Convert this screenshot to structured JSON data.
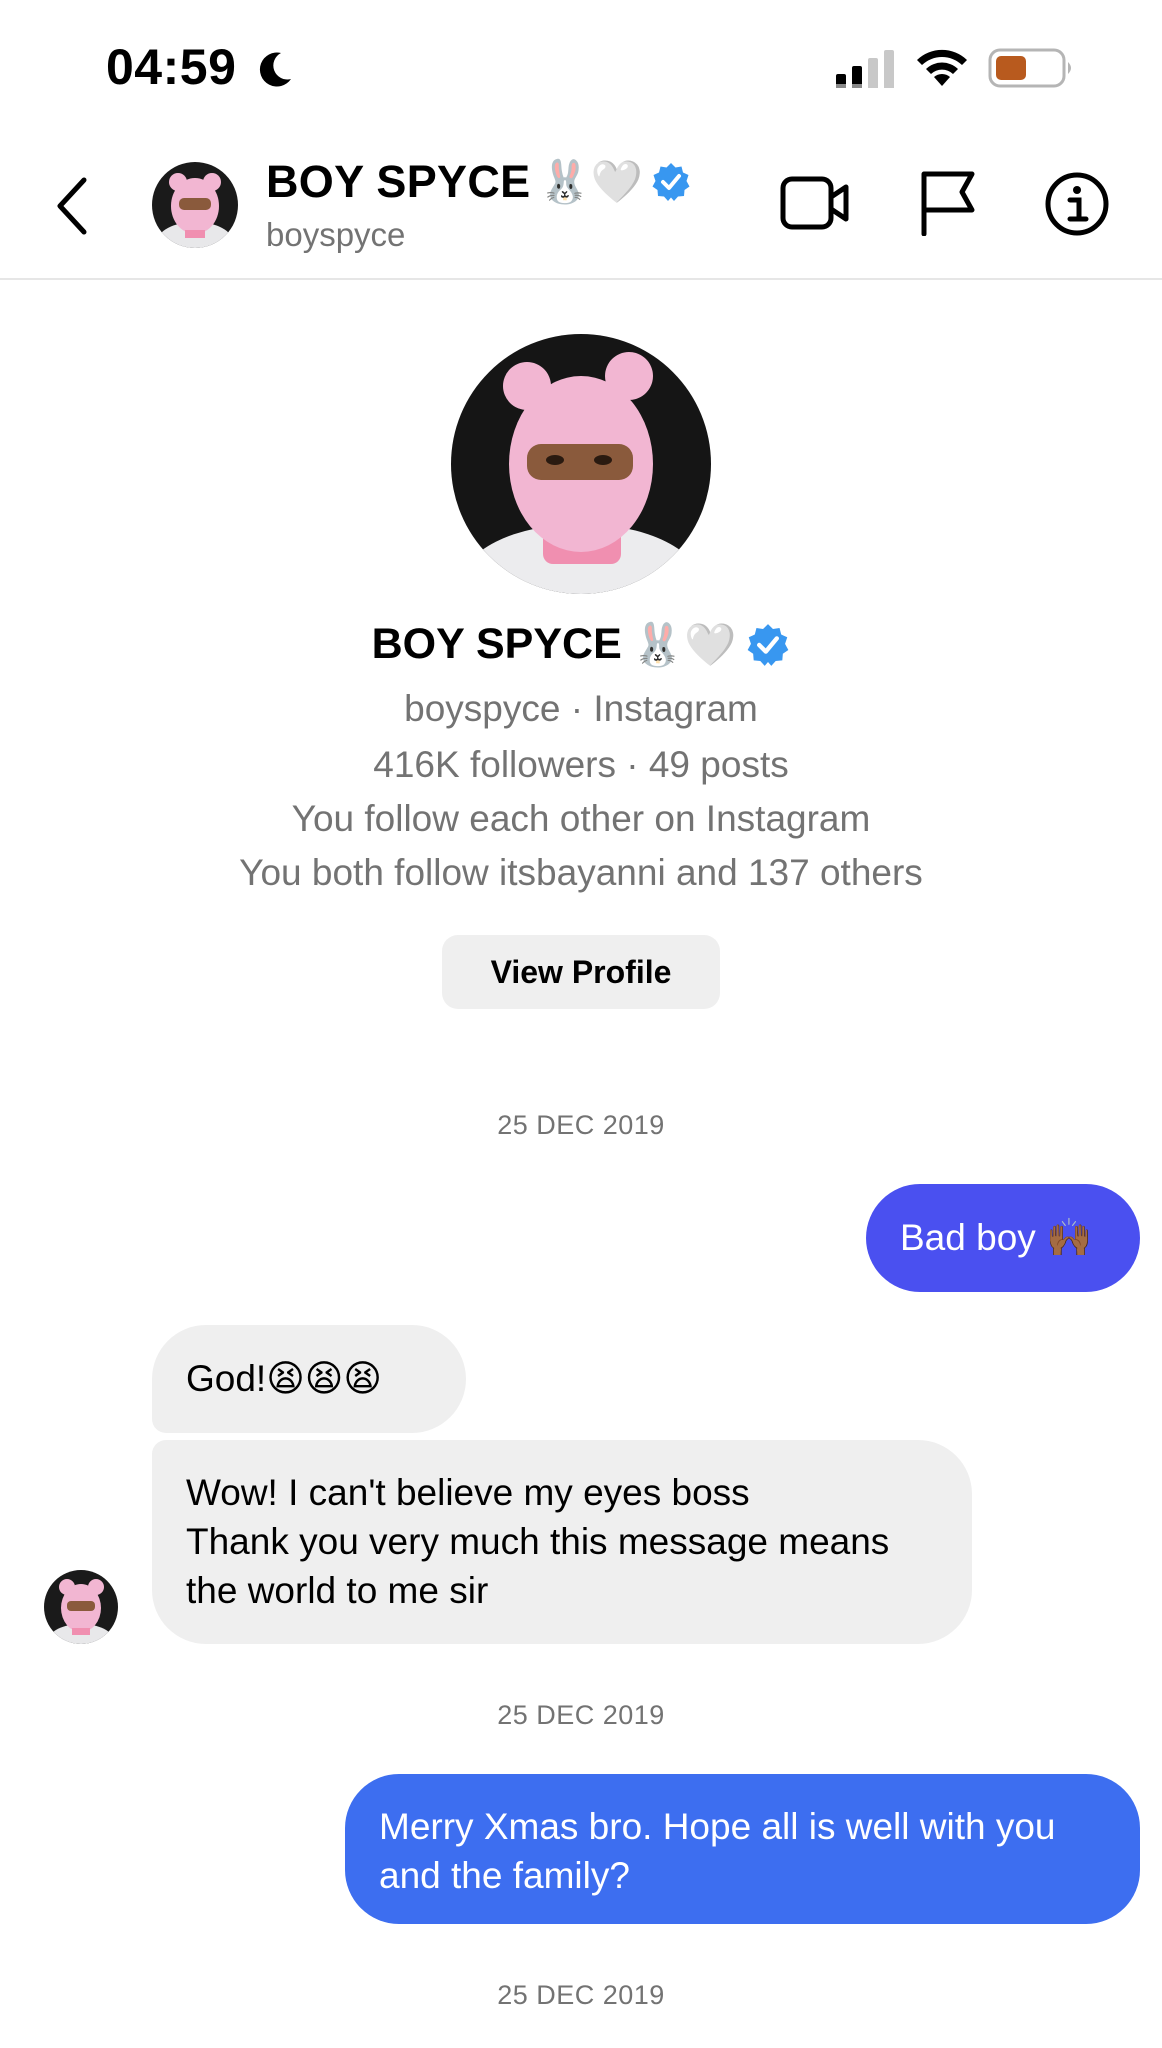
{
  "status_bar": {
    "time": "04:59",
    "icons": [
      "moon-icon",
      "signal-icon",
      "wifi-icon",
      "battery-icon"
    ]
  },
  "header": {
    "name": "BOY SPYCE",
    "emojis": "🐰🤍",
    "username": "boyspyce",
    "icons": [
      "back-icon",
      "verified-badge-icon",
      "video-call-icon",
      "flag-icon",
      "info-icon"
    ]
  },
  "profile": {
    "name": "BOY SPYCE",
    "emojis": "🐰🤍",
    "platform_line": "boyspyce · Instagram",
    "stats_line": "416K followers · 49 posts",
    "follow_line": "You follow each other on Instagram",
    "mutual_line": "You both follow itsbayanni and 137 others",
    "view_profile_label": "View Profile"
  },
  "messages": [
    {
      "type": "date",
      "text": "25 DEC 2019"
    },
    {
      "type": "outgoing",
      "text": "Bad boy 🙌🏾"
    },
    {
      "type": "incoming",
      "text": "God!😫😫😫"
    },
    {
      "type": "incoming",
      "lines": [
        "Wow! I can't believe my eyes boss",
        "Thank you very much this message means",
        "the world to me sir"
      ]
    },
    {
      "type": "date",
      "text": "25 DEC 2019"
    },
    {
      "type": "outgoing",
      "lines": [
        "Merry Xmas bro. Hope all is well with you",
        "and the family?"
      ]
    },
    {
      "type": "date",
      "text": "25 DEC 2019"
    }
  ],
  "colors": {
    "outgoing_bubble_1": "#4a50f0",
    "outgoing_bubble_2": "#3d6ef0",
    "incoming_bubble": "#efefef",
    "verified_badge": "#3897f0",
    "secondary_text": "#737373",
    "battery_fill": "#b85a1e"
  }
}
